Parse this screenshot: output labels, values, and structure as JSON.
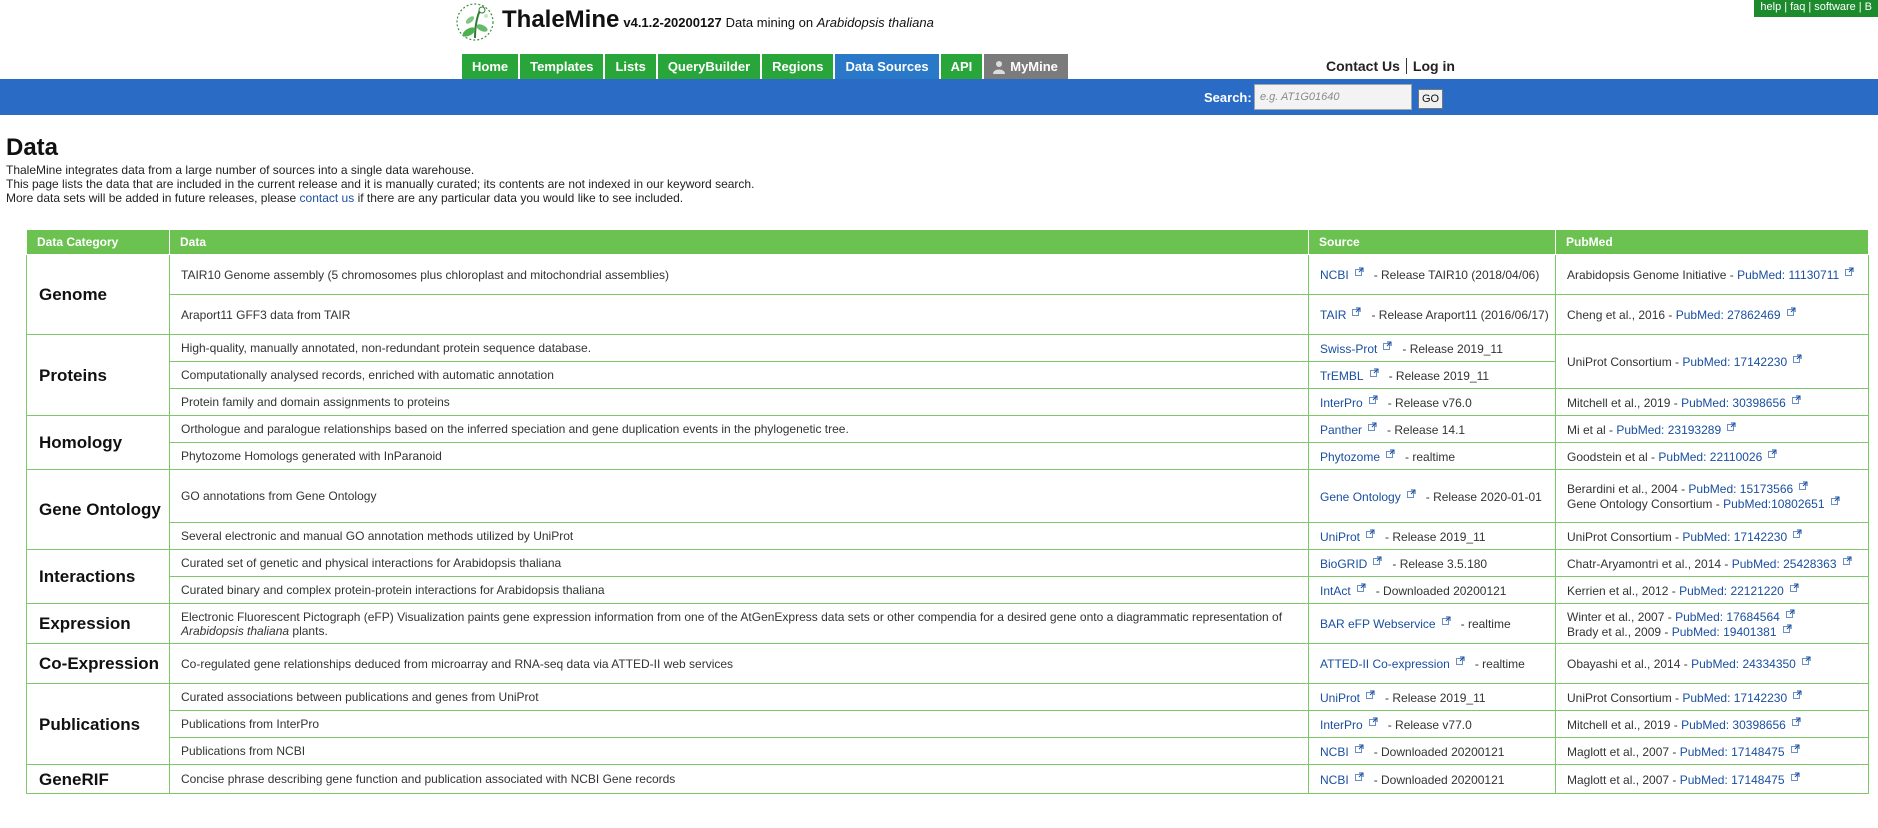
{
  "toplinks": [
    "help",
    "faq",
    "software",
    "B"
  ],
  "header": {
    "name": "ThaleMine",
    "version": "v4.1.2-20200127",
    "tagline_prefix": "Data mining on",
    "tagline_species": "Arabidopsis thaliana"
  },
  "nav": [
    {
      "label": "Home"
    },
    {
      "label": "Templates"
    },
    {
      "label": "Lists"
    },
    {
      "label": "QueryBuilder"
    },
    {
      "label": "Regions"
    },
    {
      "label": "Data Sources"
    },
    {
      "label": "API"
    },
    {
      "label": "MyMine"
    }
  ],
  "account": {
    "contact": "Contact Us",
    "login": "Log in"
  },
  "search": {
    "label": "Search:",
    "placeholder": "e.g. AT1G01640",
    "go": "GO"
  },
  "page": {
    "title": "Data",
    "intro1": "ThaleMine integrates data from a large number of sources into a single data warehouse.",
    "intro2": "This page lists the data that are included in the current release and it is manually curated; its contents are not indexed in our keyword search.",
    "intro3_pre": "More data sets will be added in future releases, please",
    "intro3_link": "contact us",
    "intro3_post": "if there are any particular data you would like to see included."
  },
  "table": {
    "headers": [
      "Data Category",
      "Data",
      "Source",
      "PubMed"
    ],
    "rows": [
      {
        "category": "Genome",
        "data": "TAIR10 Genome assembly (5 chromosomes plus chloroplast and mitochondrial assemblies)",
        "source_link": "NCBI",
        "source_note": "- Release TAIR10 (2018/04/06)",
        "pubmed_text": "Arabidopsis Genome Initiative -",
        "pubmed_link": "PubMed: 11130711"
      },
      {
        "data": "Araport11 GFF3 data from TAIR",
        "source_link": "TAIR",
        "source_note": "- Release Araport11 (2016/06/17)",
        "pubmed_text": "Cheng et al., 2016 -",
        "pubmed_link": "PubMed: 27862469"
      },
      {
        "category": "Proteins",
        "data": "High-quality, manually annotated, non-redundant protein sequence database.",
        "source_link": "Swiss-Prot",
        "source_note": "- Release 2019_11",
        "pubmed_text": "UniProt Consortium -",
        "pubmed_link": "PubMed: 17142230"
      },
      {
        "data": "Computationally analysed records, enriched with automatic annotation",
        "source_link": "TrEMBL",
        "source_note": "- Release 2019_11"
      },
      {
        "data": "Protein family and domain assignments to proteins",
        "source_link": "InterPro",
        "source_note": "- Release v76.0",
        "pubmed_text": "Mitchell et al., 2019 -",
        "pubmed_link": "PubMed: 30398656"
      },
      {
        "category": "Homology",
        "data": "Orthologue and paralogue relationships based on the inferred speciation and gene duplication events in the phylogenetic tree.",
        "source_link": "Panther",
        "source_note": "- Release 14.1",
        "pubmed_text": "Mi et al -",
        "pubmed_link": "PubMed: 23193289"
      },
      {
        "data": "Phytozome Homologs generated with InParanoid",
        "source_link": "Phytozome",
        "source_note": "- realtime",
        "pubmed_text": "Goodstein et al -",
        "pubmed_link": "PubMed: 22110026"
      },
      {
        "category": "Gene Ontology",
        "data": "GO annotations from Gene Ontology",
        "source_link": "Gene Ontology",
        "source_note": "- Release 2020-01-01",
        "pubmed_text": "Berardini et al., 2004 -",
        "pubmed_link": "PubMed: 15173566",
        "pubmed_text2": "Gene Ontology Consortium -",
        "pubmed_link2": "PubMed:10802651"
      },
      {
        "data": "Several electronic and manual GO annotation methods utilized by UniProt",
        "source_link": "UniProt",
        "source_note": "- Release 2019_11",
        "pubmed_text": "UniProt Consortium -",
        "pubmed_link": "PubMed: 17142230"
      },
      {
        "category": "Interactions",
        "data": "Curated set of genetic and physical interactions for Arabidopsis thaliana",
        "source_link": "BioGRID",
        "source_note": "- Release 3.5.180",
        "pubmed_text": "Chatr-Aryamontri et al., 2014 -",
        "pubmed_link": "PubMed: 25428363"
      },
      {
        "data": "Curated binary and complex protein-protein interactions for Arabidopsis thaliana",
        "source_link": "IntAct",
        "source_note": "- Downloaded 20200121",
        "pubmed_text": "Kerrien et al., 2012 -",
        "pubmed_link": "PubMed: 22121220"
      },
      {
        "category": "Expression",
        "data": "Electronic Fluorescent Pictograph (eFP) Visualization paints gene expression information from one of the AtGenExpress data sets or other compendia for a desired gene onto a diagrammatic representation of",
        "data_italic": "Arabidopsis thaliana",
        "data_tail": "plants.",
        "source_link": "BAR eFP Webservice",
        "source_note": "- realtime",
        "pubmed_text": "Winter et al., 2007 -",
        "pubmed_link": "PubMed: 17684564",
        "pubmed_text2": "Brady et al., 2009 -",
        "pubmed_link2": "PubMed: 19401381"
      },
      {
        "category": "Co-Expression",
        "data": "Co-regulated gene relationships deduced from microarray and RNA-seq data via ATTED-II web services",
        "source_link": "ATTED-II Co-expression",
        "source_note": "- realtime",
        "pubmed_text": "Obayashi et al., 2014 -",
        "pubmed_link": "PubMed: 24334350"
      },
      {
        "category": "Publications",
        "data": "Curated associations between publications and genes from UniProt",
        "source_link": "UniProt",
        "source_note": "- Release 2019_11",
        "pubmed_text": "UniProt Consortium -",
        "pubmed_link": "PubMed: 17142230"
      },
      {
        "data": "Publications from InterPro",
        "source_link": "InterPro",
        "source_note": "- Release v77.0",
        "pubmed_text": "Mitchell et al., 2019 -",
        "pubmed_link": "PubMed: 30398656"
      },
      {
        "data": "Publications from NCBI",
        "source_link": "NCBI",
        "source_note": "- Downloaded 20200121",
        "pubmed_text": "Maglott et al., 2007 -",
        "pubmed_link": "PubMed: 17148475"
      },
      {
        "category": "GeneRIF",
        "data": "Concise phrase describing gene function and publication associated with NCBI Gene records",
        "source_link": "NCBI",
        "source_note": "- Downloaded 20200121",
        "pubmed_text": "Maglott et al., 2007 -",
        "pubmed_link": "PubMed: 17148475"
      }
    ]
  }
}
